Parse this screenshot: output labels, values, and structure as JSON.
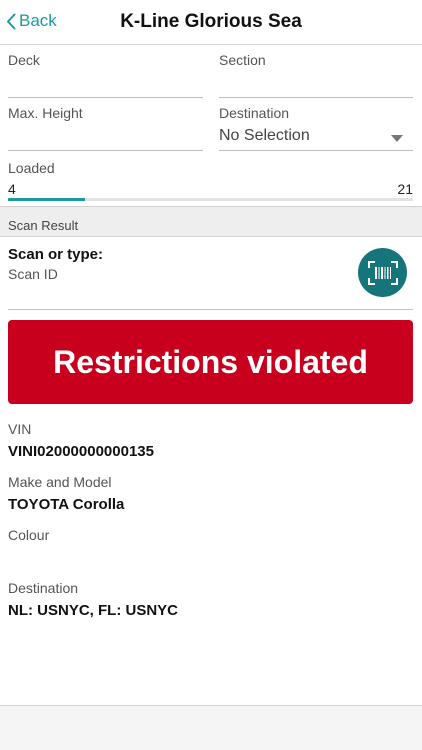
{
  "header": {
    "back_label": "Back",
    "title": "K-Line Glorious Sea"
  },
  "form": {
    "deck": {
      "label": "Deck",
      "value": ""
    },
    "section": {
      "label": "Section",
      "value": ""
    },
    "max_height": {
      "label": "Max. Height",
      "value": ""
    },
    "destination": {
      "label": "Destination",
      "value": "No Selection"
    }
  },
  "loaded": {
    "label": "Loaded",
    "current": "4",
    "total": "21",
    "progress_fraction": 0.19
  },
  "scan_result": {
    "section_title": "Scan Result",
    "prompt": "Scan or type:",
    "placeholder": "Scan ID"
  },
  "alert": {
    "message": "Restrictions violated",
    "color": "#c8001e"
  },
  "details": {
    "vin": {
      "label": "VIN",
      "value": "VINI02000000000135"
    },
    "make_model": {
      "label": "Make and Model",
      "value": "TOYOTA Corolla"
    },
    "colour": {
      "label": "Colour",
      "value": ""
    },
    "destination": {
      "label": "Destination",
      "value": "NL: USNYC, FL: USNYC"
    }
  },
  "colors": {
    "accent": "#1a9aa0",
    "scan_button": "#15757a"
  },
  "icons": {
    "back": "chevron-left-icon",
    "dropdown": "triangle-down-icon",
    "scan": "barcode-scanner-icon"
  }
}
